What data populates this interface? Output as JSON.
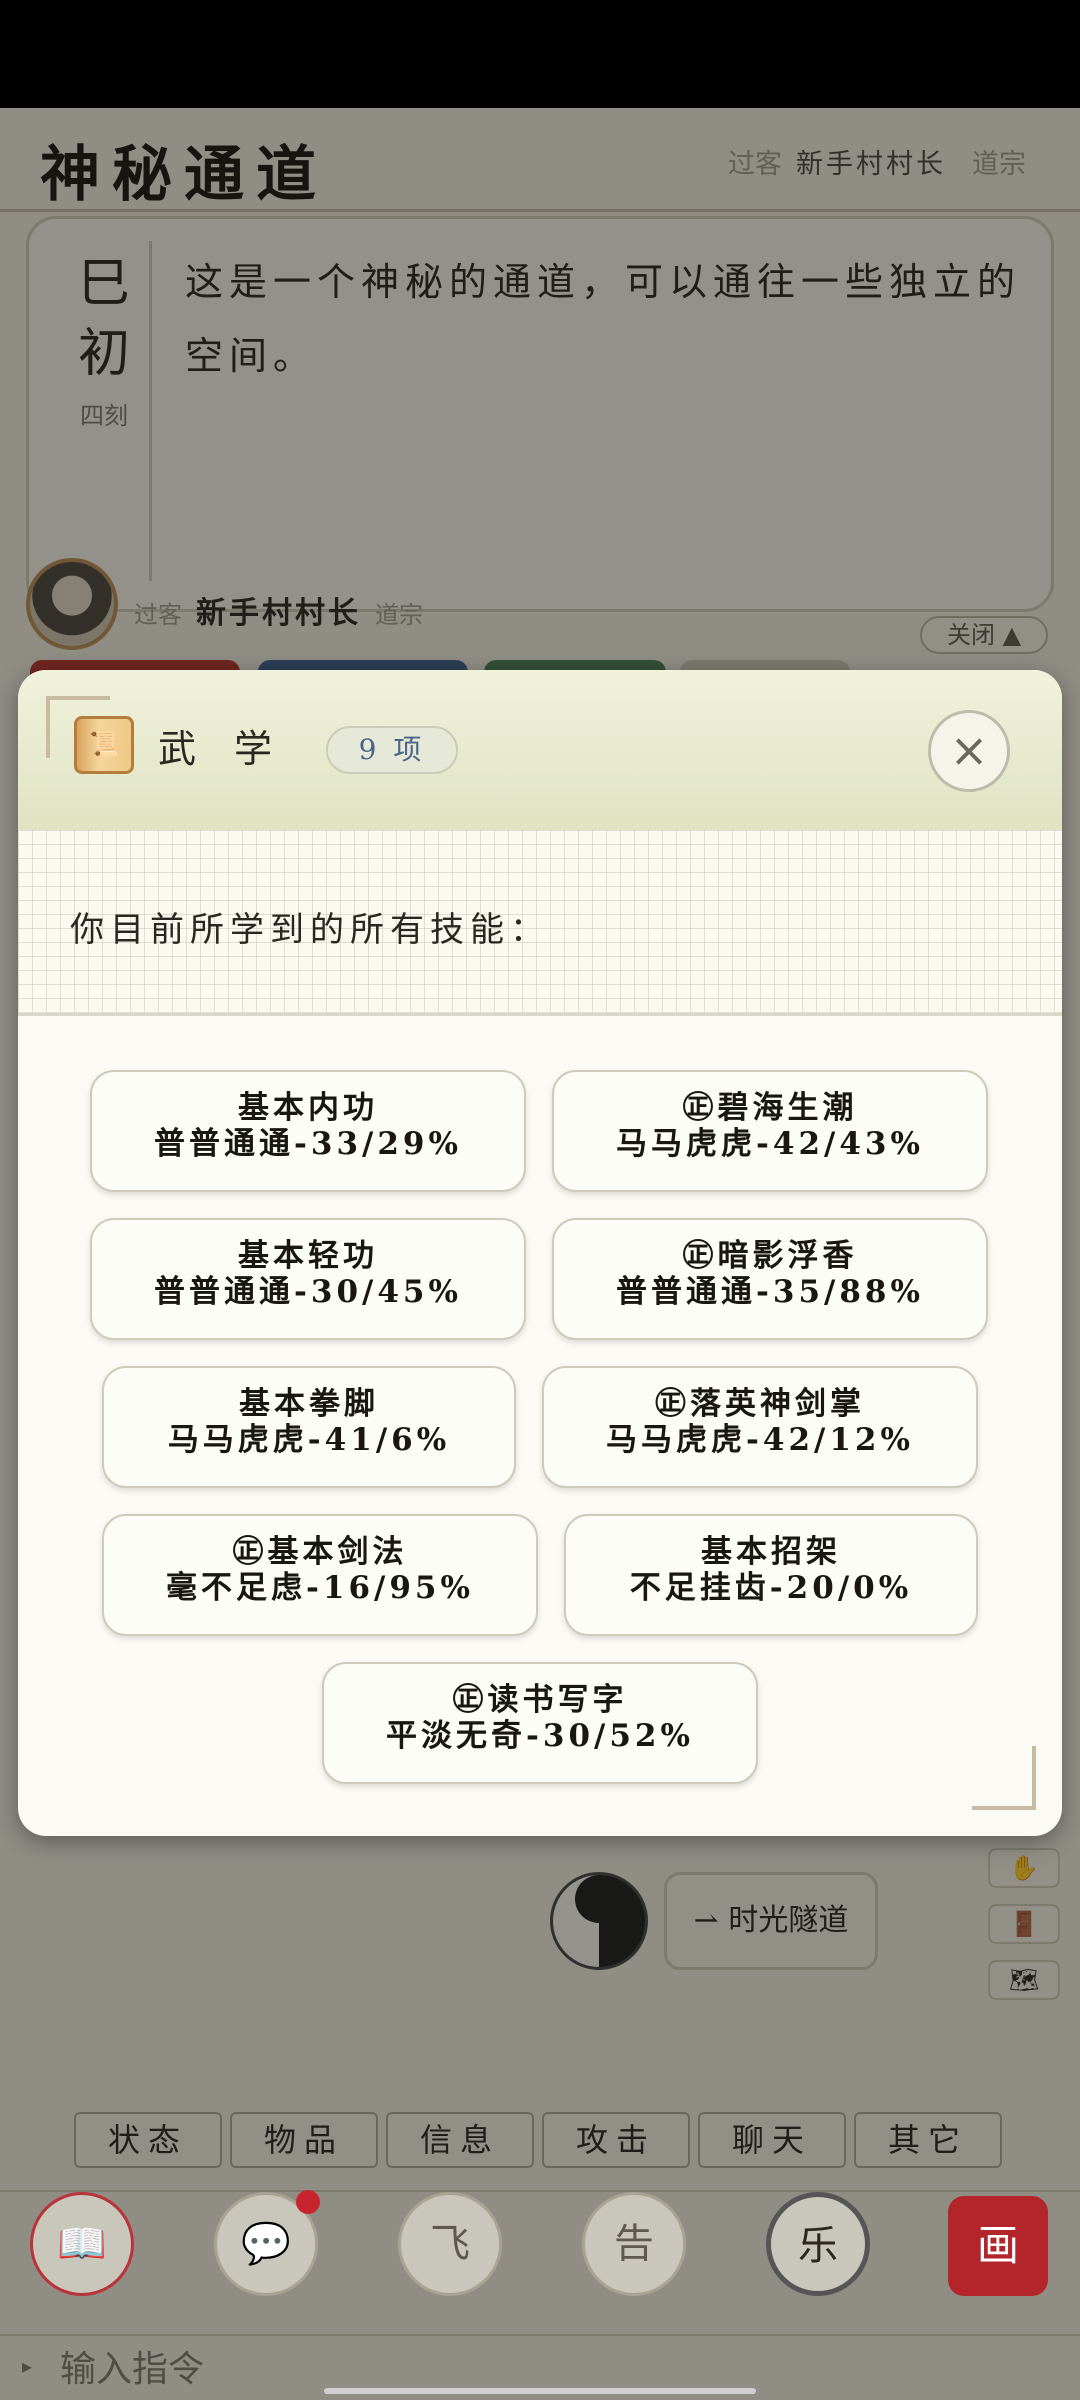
{
  "scene": {
    "title": "神秘通道",
    "guest_label": "过客",
    "player": "新手村村长",
    "sect": "道宗"
  },
  "description": {
    "time_main": "巳初",
    "time_sub": "四刻",
    "text": "这是一个神秘的通道，可以通往一些独立的空间。",
    "close_label": "关闭 ▲"
  },
  "npc": {
    "guest_label": "过客",
    "name": "新手村村长",
    "sect": "道宗"
  },
  "modal": {
    "title": "武学",
    "count": "9 项",
    "close": "×",
    "subtitle": "你目前所学到的所有技能：",
    "skills": [
      {
        "name": "基本内功",
        "stat": "普普通通-33/29%"
      },
      {
        "name": "㊣碧海生潮",
        "stat": "马马虎虎-42/43%"
      },
      {
        "name": "基本轻功",
        "stat": "普普通通-30/45%"
      },
      {
        "name": "㊣暗影浮香",
        "stat": "普普通通-35/88%"
      },
      {
        "name": "基本拳脚",
        "stat": "马马虎虎-41/6%"
      },
      {
        "name": "㊣落英神剑掌",
        "stat": "马马虎虎-42/12%"
      },
      {
        "name": "㊣基本剑法",
        "stat": "毫不足虑-16/95%"
      },
      {
        "name": "基本招架",
        "stat": "不足挂齿-20/0%"
      },
      {
        "name": "㊣读书写字",
        "stat": "平淡无奇-30/52%"
      }
    ]
  },
  "tunnel_button": "⇀ 时光隧道",
  "side_icons": [
    "✋",
    "🚪",
    "🗺"
  ],
  "tabs": [
    "状态",
    "物品",
    "信息",
    "攻击",
    "聊天",
    "其它"
  ],
  "bottom_buttons": [
    "📖",
    "💬",
    "飞",
    "告",
    "乐",
    "画"
  ],
  "command": {
    "placeholder": "输入指令"
  }
}
